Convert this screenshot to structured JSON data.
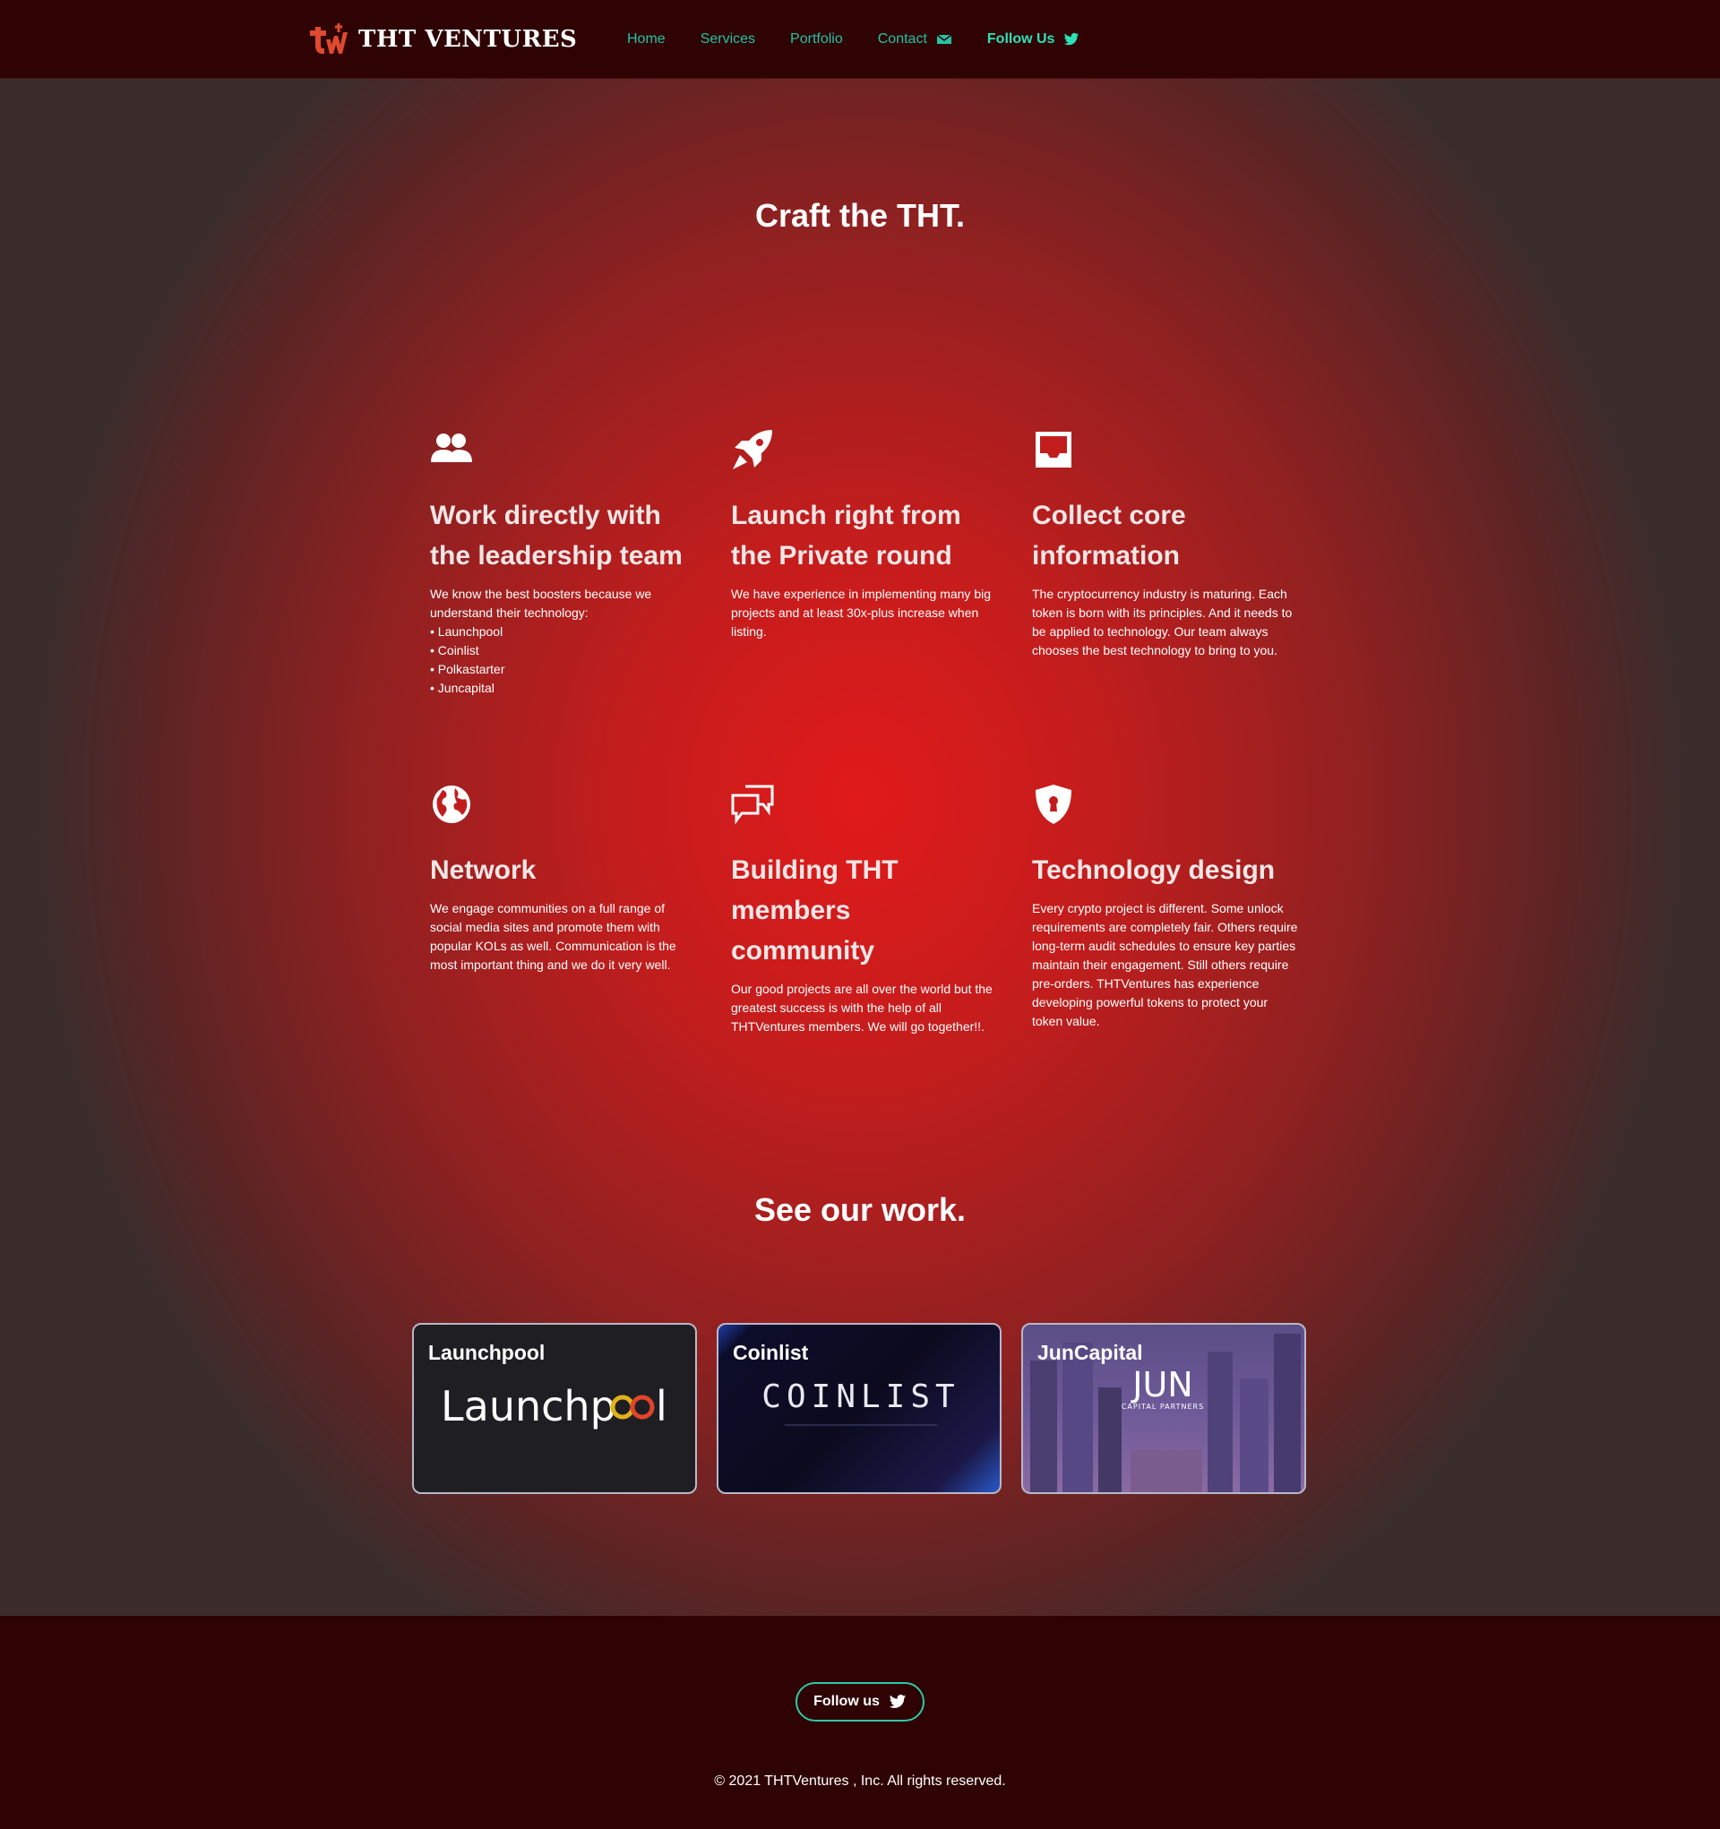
{
  "brand": {
    "name": "THT VENTURES",
    "logo_icon": "tw-monogram-icon",
    "accent": "#e04a2f"
  },
  "nav": {
    "links": [
      {
        "label": "Home"
      },
      {
        "label": "Services"
      },
      {
        "label": "Portfolio"
      },
      {
        "label": "Contact",
        "icon": "envelope-icon"
      },
      {
        "label": "Follow Us",
        "icon": "twitter-icon"
      }
    ],
    "link_color": "#26c2a6"
  },
  "hero": {
    "title": "Craft the THT."
  },
  "features": [
    {
      "icon": "users-icon",
      "title_line1": "Work directly with",
      "title_line2": "the leadership team",
      "desc": "We know the best boosters because we understand their technology:",
      "list": [
        "Launchpool",
        "Coinlist",
        "Polkastarter",
        "Juncapital"
      ]
    },
    {
      "icon": "rocket-icon",
      "title_line1": "Launch right from",
      "title_line2": "the Private round",
      "desc": "We have experience in implementing many big projects and at least 30x-plus increase when listing."
    },
    {
      "icon": "inbox-icon",
      "title_line1": "Collect core",
      "title_line2": "information",
      "desc": "The cryptocurrency industry is maturing. Each token is born with its principles. And it needs to be applied to technology. Our team always chooses the best technology to bring to you."
    },
    {
      "icon": "globe-icon",
      "title_line1": "Network",
      "desc": "We engage communities on a full range of social media sites and promote them with popular KOLs as well. Communication is the most important thing and we do it very well."
    },
    {
      "icon": "chat-bubbles-icon",
      "title_line1": "Building THT",
      "title_line2": "members community",
      "desc": "Our good projects are all over the world but the greatest success is with the help of all THTVentures members. We will go together!!."
    },
    {
      "icon": "shield-lock-icon",
      "title_line1": "Technology design",
      "desc": "Every crypto project is different. Some unlock requirements are completely fair. Others require long-term audit schedules to ensure key parties maintain their engagement. Still others require pre-orders. THTVentures has experience developing powerful tokens to protect your token value."
    }
  ],
  "work": {
    "title": "See our work.",
    "cards": [
      {
        "label": "Launchpool",
        "logo_text": "Launchpool"
      },
      {
        "label": "Coinlist",
        "logo_text": "COINLIST"
      },
      {
        "label": "JunCapital",
        "logo_text": "JUN",
        "logo_sub": "CAPITAL PARTNERS"
      }
    ]
  },
  "footer": {
    "follow_label": "Follow us",
    "follow_icon": "twitter-icon",
    "copyright": "© 2021 THTVentures , Inc. All rights reserved.",
    "button_border": "#2fc7a8"
  }
}
